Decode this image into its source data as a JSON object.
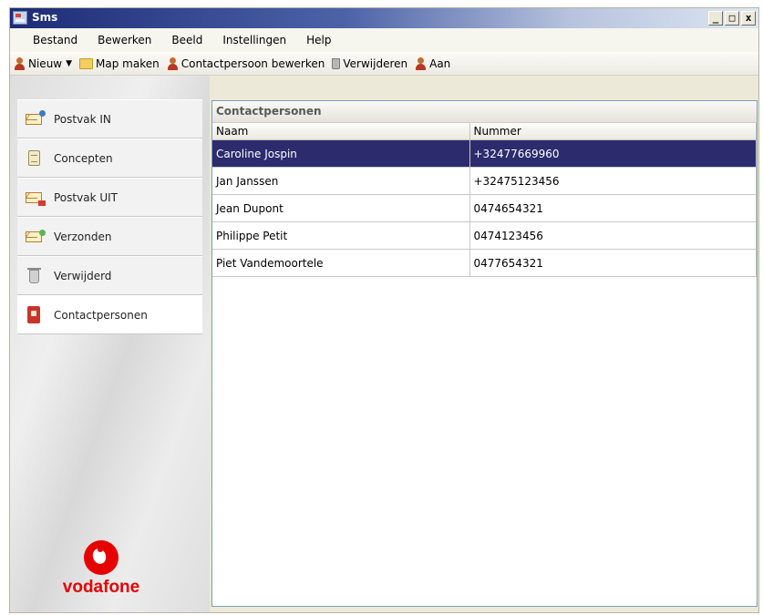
{
  "window": {
    "title": "Sms",
    "controls": [
      "_",
      "□",
      "x"
    ]
  },
  "menu": [
    "Bestand",
    "Bewerken",
    "Beeld",
    "Instellingen",
    "Help"
  ],
  "toolbar": {
    "new": "Nieuw",
    "new_dropdown_icon": "chevron-down-icon",
    "make_folder": "Map maken",
    "edit_contact": "Contactpersoon bewerken",
    "delete": "Verwijderen",
    "on": "Aan"
  },
  "sidebar": {
    "items": [
      {
        "label": "Postvak IN",
        "icon": "inbox-icon"
      },
      {
        "label": "Concepten",
        "icon": "drafts-icon"
      },
      {
        "label": "Postvak UIT",
        "icon": "outbox-icon"
      },
      {
        "label": "Verzonden",
        "icon": "sent-icon"
      },
      {
        "label": "Verwijderd",
        "icon": "trash-icon"
      },
      {
        "label": "Contactpersonen",
        "icon": "contacts-icon"
      }
    ],
    "active": "Contactpersonen",
    "logo_text": "vodafone"
  },
  "contacts": {
    "heading": "Contactpersonen",
    "columns": {
      "name": "Naam",
      "number": "Nummer"
    },
    "rows": [
      {
        "name": "Caroline Jospin",
        "number": "+32477669960"
      },
      {
        "name": "Jan Janssen",
        "number": "+32475123456"
      },
      {
        "name": "Jean Dupont",
        "number": "0474654321"
      },
      {
        "name": "Philippe Petit",
        "number": "0474123456"
      },
      {
        "name": "Piet Vandemoortele",
        "number": "0477654321"
      }
    ]
  },
  "colors": {
    "selection": "#2b2b6e",
    "vodafone_red": "#e60000",
    "titlebar": "#1c2b76"
  }
}
